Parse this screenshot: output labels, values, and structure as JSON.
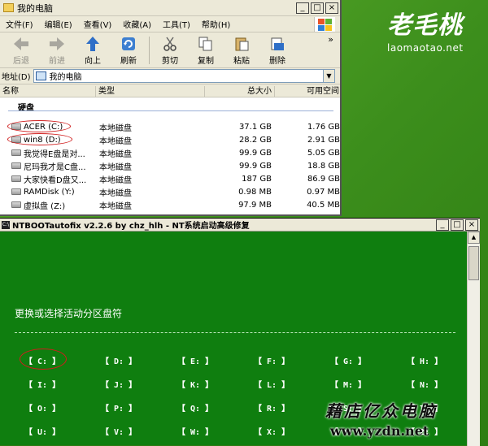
{
  "brand": {
    "cn": "老毛桃",
    "en": "laomaotao.net"
  },
  "explorer": {
    "title": "我的电脑",
    "menu": [
      "文件(F)",
      "编辑(E)",
      "查看(V)",
      "收藏(A)",
      "工具(T)",
      "帮助(H)"
    ],
    "toolbar": {
      "back": "后退",
      "forward": "前进",
      "up": "向上",
      "refresh": "刷新",
      "cut": "剪切",
      "copy": "复制",
      "paste": "粘贴",
      "delete": "删除",
      "more": "»"
    },
    "address": {
      "label": "地址(D)",
      "value": "我的电脑"
    },
    "columns": {
      "name": "名称",
      "type": "类型",
      "total": "总大小",
      "free": "可用空间"
    },
    "group": "硬盘",
    "drives": [
      {
        "name": "ACER (C:)",
        "type": "本地磁盘",
        "total": "37.1 GB",
        "free": "1.76 GB"
      },
      {
        "name": "win8 (D:)",
        "type": "本地磁盘",
        "total": "28.2 GB",
        "free": "2.91 GB"
      },
      {
        "name": "我觉得E盘是对...",
        "type": "本地磁盘",
        "total": "99.9 GB",
        "free": "5.05 GB"
      },
      {
        "name": "尼玛我才是C盘...",
        "type": "本地磁盘",
        "total": "99.9 GB",
        "free": "18.8 GB"
      },
      {
        "name": "大家快看D盘又...",
        "type": "本地磁盘",
        "total": "187 GB",
        "free": "86.9 GB"
      },
      {
        "name": "RAMDisk (Y:)",
        "type": "本地磁盘",
        "total": "0.98 MB",
        "free": "0.97 MB"
      },
      {
        "name": "虚拟盘 (Z:)",
        "type": "本地磁盘",
        "total": "97.9 MB",
        "free": "40.5 MB"
      }
    ]
  },
  "console": {
    "icon": "C:\\",
    "title": "NTBOOTautofix v2.2.6 by chz_hlh - NT系统启动高级修复",
    "prompt": "更换或选择活动分区盘符",
    "drive_buttons": [
      "【 C: 】",
      "【 D: 】",
      "【 E: 】",
      "【 F: 】",
      "【 G: 】",
      "【 H: 】",
      "【 I: 】",
      "【 J: 】",
      "【 K: 】",
      "【 L: 】",
      "【 M: 】",
      "【 N: 】",
      "【 O: 】",
      "【 P: 】",
      "【 Q: 】",
      "【 R: 】",
      "【 S: 】",
      "【 T: 】",
      "【 U: 】",
      "【 V: 】",
      "【 W: 】",
      "【 X: 】",
      "【 Y: 】",
      "【 Z: 】"
    ]
  },
  "watermark": {
    "cn": "藉店亿众电脑",
    "en": "www.yzdn.net"
  },
  "window_buttons": {
    "minimize": "_",
    "maximize": "□",
    "close": "×"
  }
}
